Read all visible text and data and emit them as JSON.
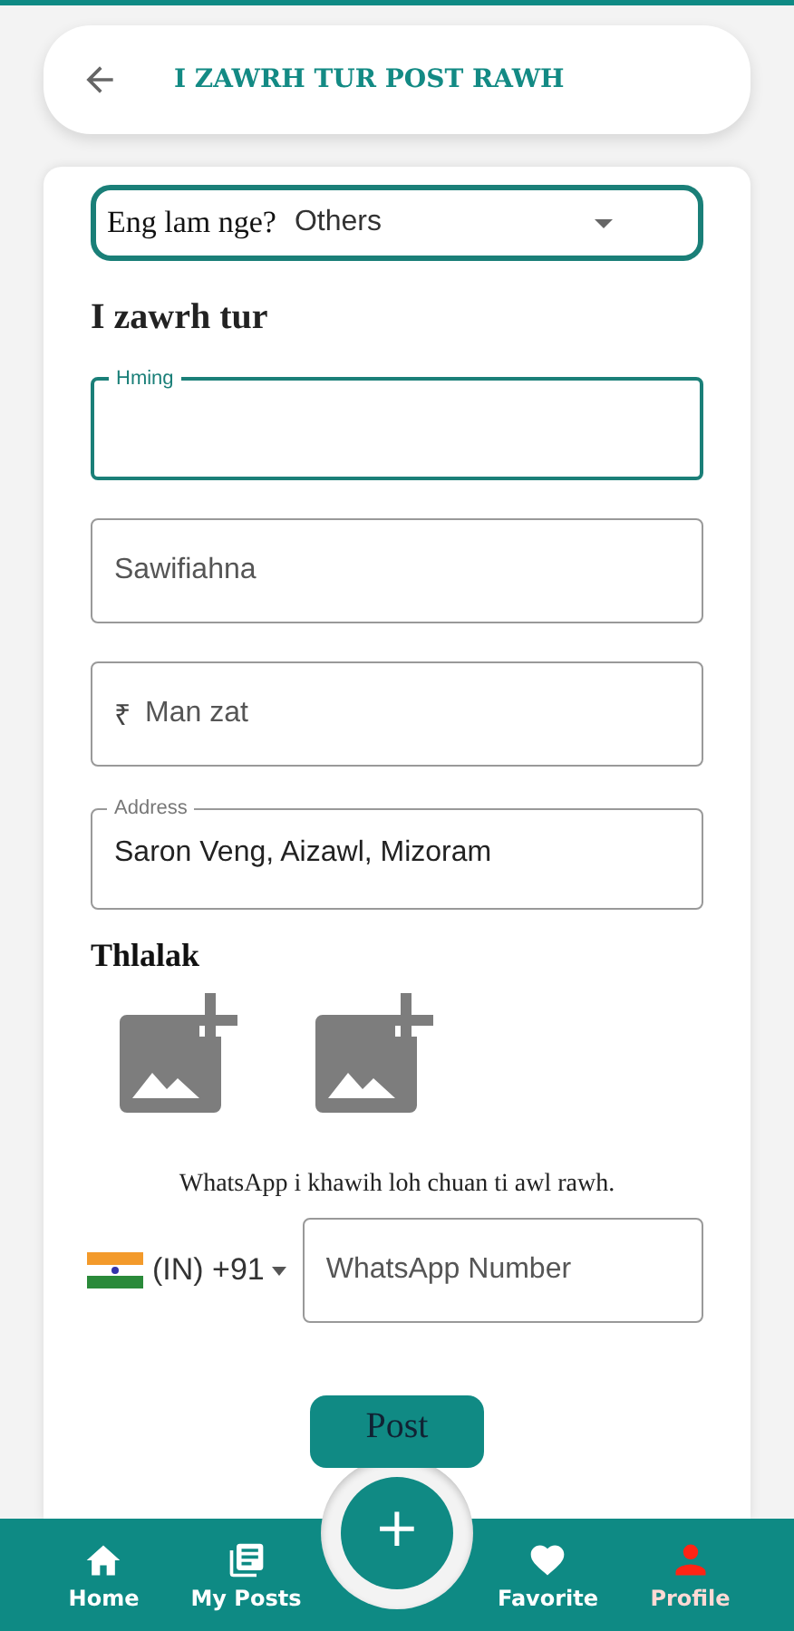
{
  "header": {
    "title": "I ZAWRH TUR POST RAWH"
  },
  "category": {
    "label": "Eng lam nge?",
    "value": "Others"
  },
  "section_title": "I zawrh tur",
  "fields": [
    {
      "label": "Hming",
      "focused": true
    },
    {
      "placeholder": "Sawifiahna",
      "focused": false
    },
    {
      "prefix": "₹",
      "placeholder": "Man zat",
      "focused": false
    },
    {
      "label": "Address",
      "value": "Saron Veng, Aizawl, Mizoram",
      "focused": false
    }
  ],
  "photos": {
    "title": "Thlalak",
    "slots": [
      {
        "kind": "add"
      },
      {
        "kind": "add"
      }
    ]
  },
  "whatsapp": {
    "note": "WhatsApp i khawih loh chuan ti awl rawh.",
    "country": "(IN) +91",
    "placeholder": "WhatsApp Number"
  },
  "post_button": "Post",
  "fab": "+",
  "nav": [
    {
      "kind": "home",
      "label": "Home",
      "selected": false
    },
    {
      "kind": "posts",
      "label": "My Posts",
      "selected": false
    },
    {
      "kind": "favorite",
      "label": "Favorite",
      "selected": false
    },
    {
      "kind": "profile",
      "label": "Profile",
      "selected": true
    }
  ]
}
